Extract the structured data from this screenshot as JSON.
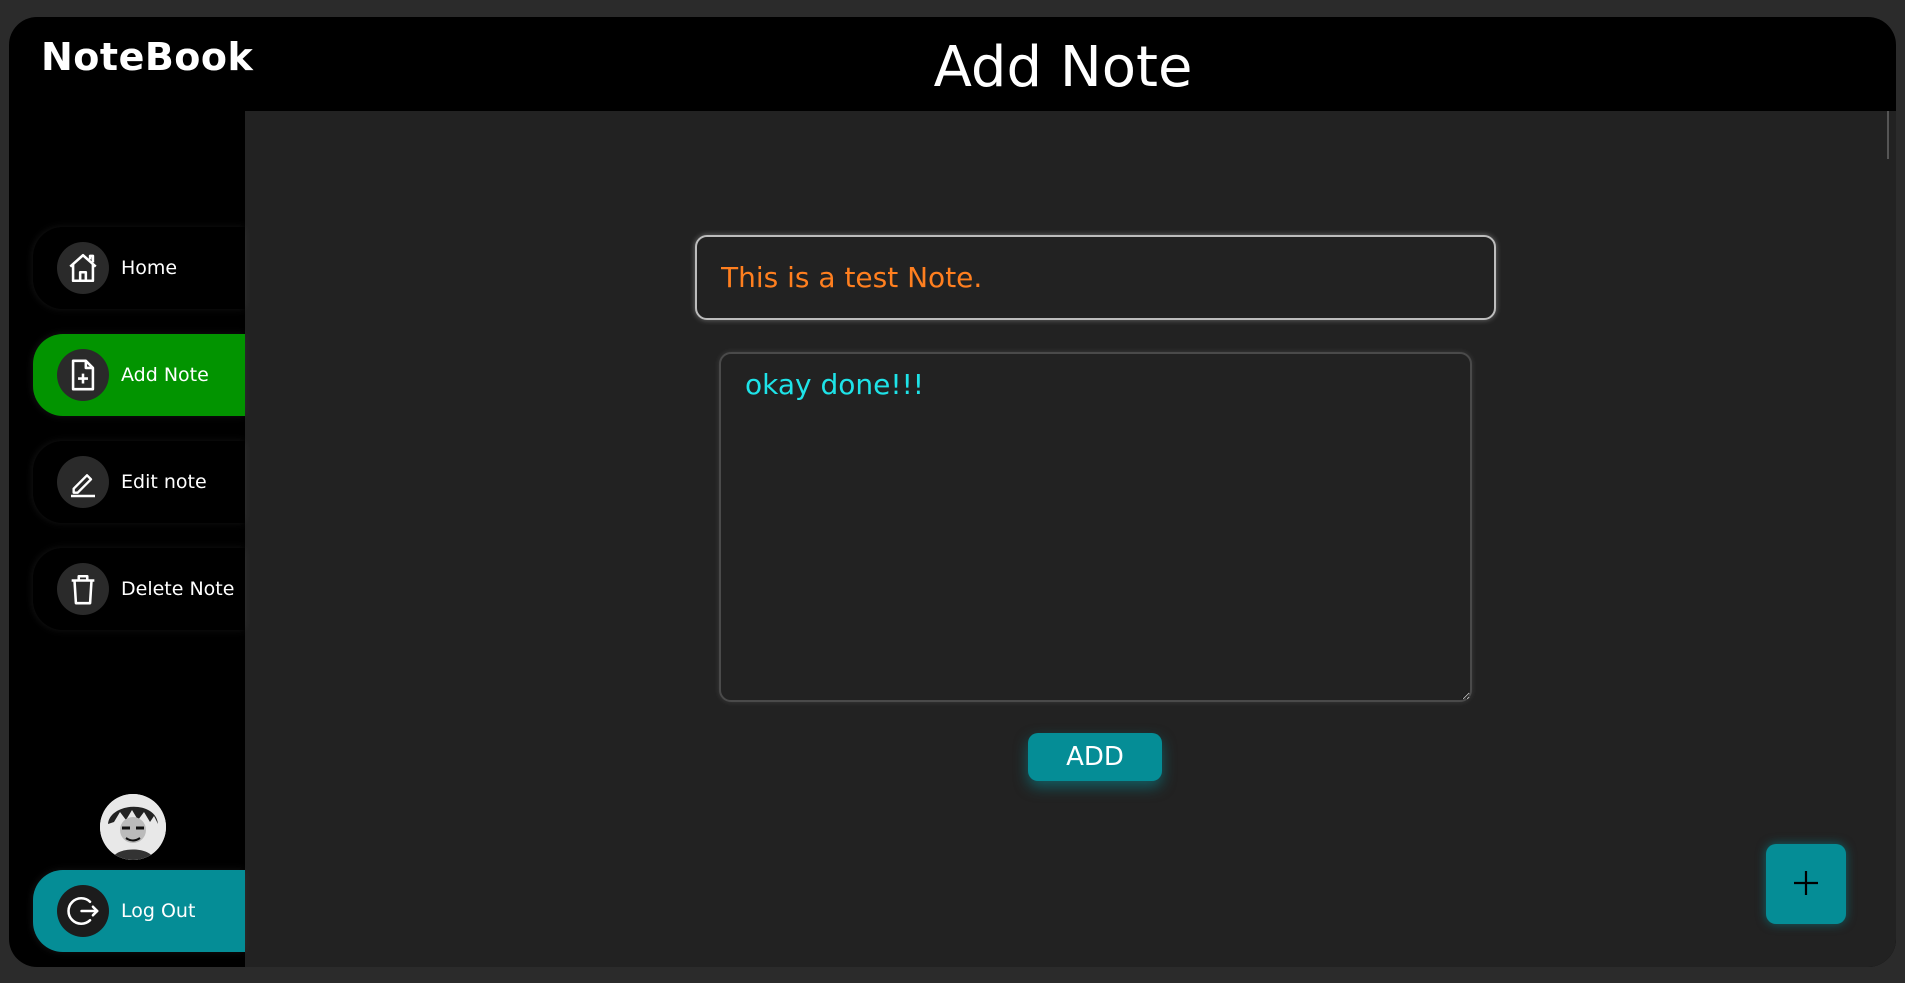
{
  "app": {
    "brand": "NoteBook",
    "page_title": "Add Note"
  },
  "sidebar": {
    "items": [
      {
        "label": "Home",
        "icon": "home-icon"
      },
      {
        "label": "Add Note",
        "icon": "file-plus-icon",
        "active": true
      },
      {
        "label": "Edit note",
        "icon": "pencil-icon"
      },
      {
        "label": "Delete Note",
        "icon": "trash-icon"
      }
    ],
    "logout_label": "Log Out",
    "logout_icon": "logout-icon",
    "avatar": "user-avatar"
  },
  "form": {
    "title_value": "This is a test Note.",
    "body_value": "okay done!!!",
    "add_label": "ADD"
  },
  "fab": {
    "icon": "plus-icon"
  },
  "colors": {
    "active_nav": "#029400",
    "accent": "#058d96",
    "title_text": "#ff7f1f",
    "body_text": "#1ee3e8"
  }
}
